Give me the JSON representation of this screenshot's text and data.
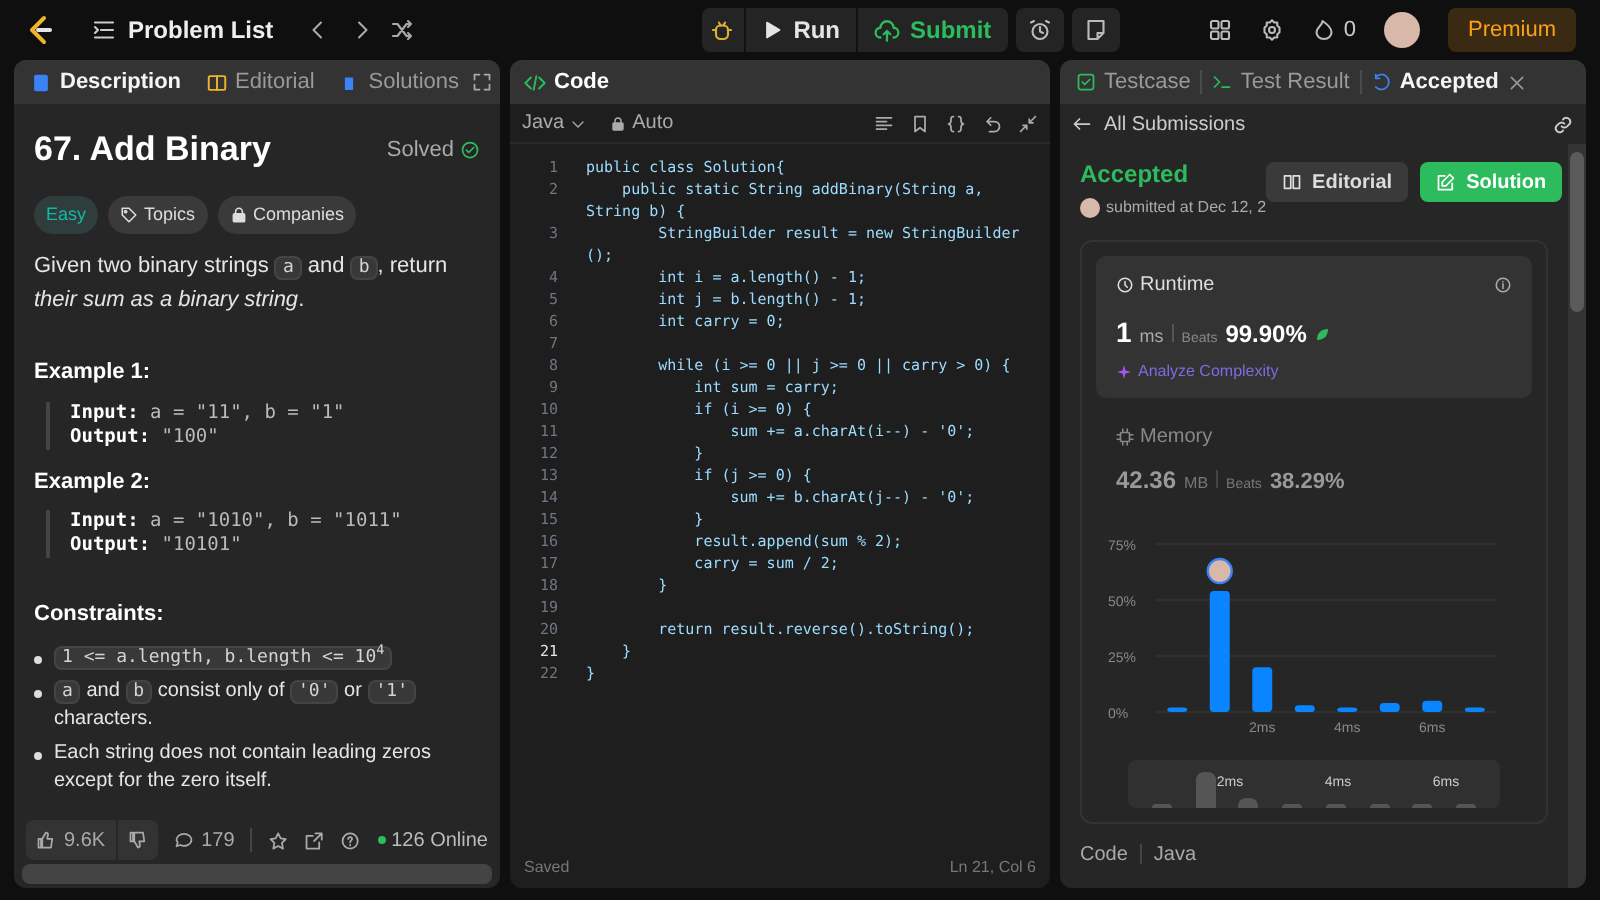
{
  "top_bar": {
    "problem_list": "Problem List",
    "run": "Run",
    "submit": "Submit",
    "streak": "0",
    "premium": "Premium"
  },
  "description": {
    "tabs": [
      {
        "label": "Description",
        "selected": true
      },
      {
        "label": "Editorial",
        "selected": false
      },
      {
        "label": "Solutions",
        "selected": false
      }
    ],
    "title": "67. Add Binary",
    "status": "Solved",
    "difficulty": "Easy",
    "tags": [
      "Topics",
      "Companies"
    ],
    "statement": [
      {
        "kind": "text",
        "text": "Given two binary strings "
      },
      {
        "kind": "code",
        "text": "a"
      },
      {
        "kind": "text",
        "text": " and "
      },
      {
        "kind": "code",
        "text": "b"
      },
      {
        "kind": "text",
        "text": ", return "
      },
      {
        "kind": "em",
        "text": "their sum as a binary string"
      },
      {
        "kind": "text",
        "text": "."
      }
    ],
    "examples": [
      {
        "title": "Example 1:",
        "input_label": "Input:",
        "input": "a = \"11\", b = \"1\"",
        "output_label": "Output:",
        "output": "\"100\""
      },
      {
        "title": "Example 2:",
        "input_label": "Input:",
        "input": "a = \"1010\", b = \"1011\"",
        "output_label": "Output:",
        "output": "\"10101\""
      }
    ],
    "constraints_title": "Constraints:",
    "constraints": [
      [
        {
          "kind": "code",
          "text": "1 <= a.length, b.length <= 10$^{4}$"
        }
      ],
      [
        {
          "kind": "code",
          "text": "a"
        },
        {
          "kind": "text",
          "text": " and "
        },
        {
          "kind": "code",
          "text": "b"
        },
        {
          "kind": "text",
          "text": " consist only of "
        },
        {
          "kind": "code",
          "text": "'0'"
        },
        {
          "kind": "text",
          "text": " or "
        },
        {
          "kind": "code",
          "text": "'1'"
        },
        {
          "kind": "text",
          "text": " characters."
        }
      ],
      [
        {
          "kind": "text",
          "text": "Each string does not contain leading zeros except for the zero itself."
        }
      ]
    ],
    "likes": "9.6K",
    "comments": "179",
    "online": "126 Online"
  },
  "editor": {
    "title": "Code",
    "language": "Java",
    "mode": "Auto",
    "lines": [
      {
        "number": "1",
        "text": "public class Solution{",
        "current": false
      },
      {
        "number": "2",
        "text": "    public static String addBinary(String a,",
        "continuation": "String b) {",
        "current": false
      },
      {
        "number": "3",
        "text": "        StringBuilder result = new StringBuilder",
        "continuation": "();",
        "current": false
      },
      {
        "number": "4",
        "text": "        int i = a.length() - 1;",
        "current": false
      },
      {
        "number": "5",
        "text": "        int j = b.length() - 1;",
        "current": false
      },
      {
        "number": "6",
        "text": "        int carry = 0;",
        "current": false
      },
      {
        "number": "7",
        "current": false
      },
      {
        "number": "8",
        "text": "        while (i >= 0 || j >= 0 || carry > 0) {",
        "current": false
      },
      {
        "number": "9",
        "text": "            int sum = carry;",
        "current": false
      },
      {
        "number": "10",
        "text": "            if (i >= 0) {",
        "current": false
      },
      {
        "number": "11",
        "text": "                sum += a.charAt(i--) - '0';",
        "current": false
      },
      {
        "number": "12",
        "text": "            }",
        "current": false
      },
      {
        "number": "13",
        "text": "            if (j >= 0) {",
        "current": false
      },
      {
        "number": "14",
        "text": "                sum += b.charAt(j--) - '0';",
        "current": false
      },
      {
        "number": "15",
        "text": "            }",
        "current": false
      },
      {
        "number": "16",
        "text": "            result.append(sum % 2);",
        "current": false
      },
      {
        "number": "17",
        "text": "            carry = sum / 2;",
        "current": false
      },
      {
        "number": "18",
        "text": "        }",
        "current": false
      },
      {
        "number": "19",
        "current": false
      },
      {
        "number": "20",
        "text": "        return result.reverse().toString();",
        "current": false
      },
      {
        "number": "21",
        "text": "    }",
        "current": true
      },
      {
        "number": "22",
        "text": "}",
        "current": false
      }
    ],
    "status": "Saved",
    "cursor": "Ln 21, Col 6"
  },
  "result": {
    "tabs": [
      {
        "label": "Testcase",
        "selected": false
      },
      {
        "label": "Test Result",
        "selected": false
      },
      {
        "label": "Accepted",
        "selected": true
      }
    ],
    "back": "All Submissions",
    "verdict": "Accepted",
    "submitted": "submitted at Dec 12, 2",
    "buttons": [
      "Editorial",
      "Solution"
    ],
    "runtime": {
      "label": "Runtime",
      "value": "1",
      "unit": "ms",
      "beats_label": "Beats",
      "beats": "99.90%",
      "analyze": "Analyze Complexity"
    },
    "memory": {
      "label": "Memory",
      "value": "42.36",
      "unit": "MB",
      "beats_label": "Beats",
      "beats": "38.29%"
    },
    "chart_data": {
      "type": "bar",
      "x": [
        0,
        1,
        2,
        3,
        4,
        5,
        6,
        7
      ],
      "xlim": [
        -0.5,
        7.5
      ],
      "series": [
        {
          "color": "#0a84ff",
          "values": [
            2,
            54,
            20,
            3,
            2,
            4,
            5,
            2
          ]
        }
      ],
      "ylim": [
        0,
        75
      ],
      "yticks": [
        {
          "value": 0,
          "label": "0%"
        },
        {
          "value": 25,
          "label": "25%"
        },
        {
          "value": 50,
          "label": "50%"
        },
        {
          "value": 75,
          "label": "75%"
        }
      ],
      "xticks": [
        {
          "value": 2,
          "label": "2ms"
        },
        {
          "value": 4,
          "label": "4ms"
        },
        {
          "value": 6,
          "label": "6ms"
        }
      ]
    },
    "overview_labels": [
      "2ms",
      "4ms",
      "6ms"
    ],
    "footer": [
      "Code",
      "Java"
    ]
  }
}
